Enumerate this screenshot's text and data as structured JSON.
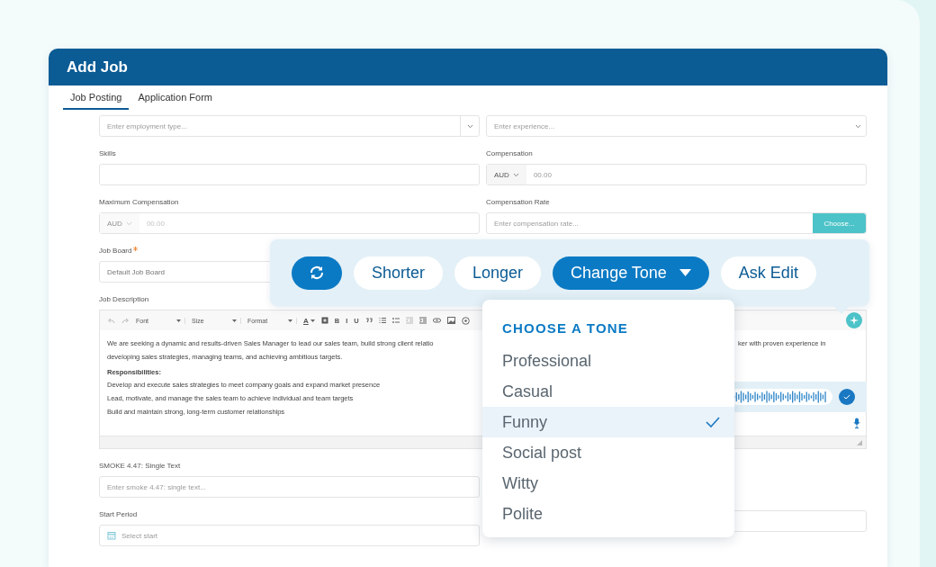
{
  "window": {
    "title": "Add Job"
  },
  "tabs": [
    {
      "label": "Job Posting",
      "selected": true
    },
    {
      "label": "Application Form",
      "selected": false
    }
  ],
  "form": {
    "rows": [
      [
        {
          "kind": "select",
          "placeholder": "Enter employment type...",
          "split_caret": true
        },
        {
          "kind": "select",
          "placeholder": "Enter experience...",
          "split_caret": false
        }
      ],
      [
        {
          "kind": "text",
          "label": "Skills"
        },
        {
          "kind": "money",
          "label": "Compensation",
          "currency": "AUD",
          "placeholder": "00.00",
          "disabled": false
        }
      ],
      [
        {
          "kind": "money",
          "label": "Maximum Compensation",
          "currency": "AUD",
          "placeholder": "00.00",
          "disabled": true
        },
        {
          "kind": "choose",
          "label": "Compensation Rate",
          "placeholder": "Enter compensation rate...",
          "button": "Choose..."
        }
      ],
      [
        {
          "kind": "text",
          "label": "Job Board",
          "required": true,
          "value": "Default Job Board"
        }
      ],
      [
        {
          "kind": "editor",
          "label": "Job Description"
        }
      ],
      [
        {
          "kind": "text",
          "label": "SMOKE 4.47: Single Text",
          "placeholder": "Enter smoke 4.47: single text..."
        }
      ],
      [
        {
          "kind": "date",
          "label": "Start Period",
          "placeholder": "Select start"
        },
        {
          "kind": "date"
        }
      ]
    ]
  },
  "editor": {
    "toolbar": [
      {
        "kind": "undo"
      },
      {
        "kind": "redo"
      },
      {
        "kind": "select",
        "label": "Font"
      },
      {
        "kind": "select",
        "label": "Size"
      },
      {
        "kind": "select",
        "label": "Format"
      },
      {
        "kind": "color",
        "label": "A"
      },
      {
        "kind": "highlight"
      },
      {
        "kind": "char",
        "label": "B"
      },
      {
        "kind": "char",
        "label": "I"
      },
      {
        "kind": "char",
        "label": "U"
      },
      {
        "kind": "quote"
      },
      {
        "kind": "ol"
      },
      {
        "kind": "ul"
      },
      {
        "kind": "outdent"
      },
      {
        "kind": "indent"
      },
      {
        "kind": "link"
      },
      {
        "kind": "image"
      },
      {
        "kind": "embed"
      }
    ],
    "lines": [
      {
        "kind": "text",
        "text": "We are seeking a dynamic and results-driven Sales Manager to lead our sales team, build strong client relatio"
      },
      {
        "kind": "text",
        "text": "developing sales strategies, managing teams, and achieving ambitious targets."
      },
      {
        "kind": "heading",
        "text": "Responsibilities:"
      },
      {
        "kind": "text",
        "text": "Develop and execute sales strategies to meet company goals and expand market presence"
      },
      {
        "kind": "text",
        "text": "Lead, motivate, and manage the sales team to achieve individual and team targets"
      },
      {
        "kind": "text",
        "text": "Build and maintain strong, long-term customer relationships"
      }
    ],
    "right_fragment": "ker with proven experience in"
  },
  "ai_toolbar": {
    "buttons": [
      {
        "kind": "icon",
        "active": true
      },
      {
        "kind": "text",
        "label": "Shorter",
        "active": false
      },
      {
        "kind": "text",
        "label": "Longer",
        "active": false
      },
      {
        "kind": "menu",
        "label": "Change Tone",
        "active": true
      },
      {
        "kind": "text",
        "label": "Ask Edit",
        "active": false
      }
    ]
  },
  "tone_menu": {
    "heading": "CHOOSE A TONE",
    "options": [
      {
        "label": "Professional",
        "selected": false
      },
      {
        "label": "Casual",
        "selected": false
      },
      {
        "label": "Funny",
        "selected": true
      },
      {
        "label": "Social post",
        "selected": false
      },
      {
        "label": "Witty",
        "selected": false
      },
      {
        "label": "Polite",
        "selected": false
      }
    ]
  }
}
